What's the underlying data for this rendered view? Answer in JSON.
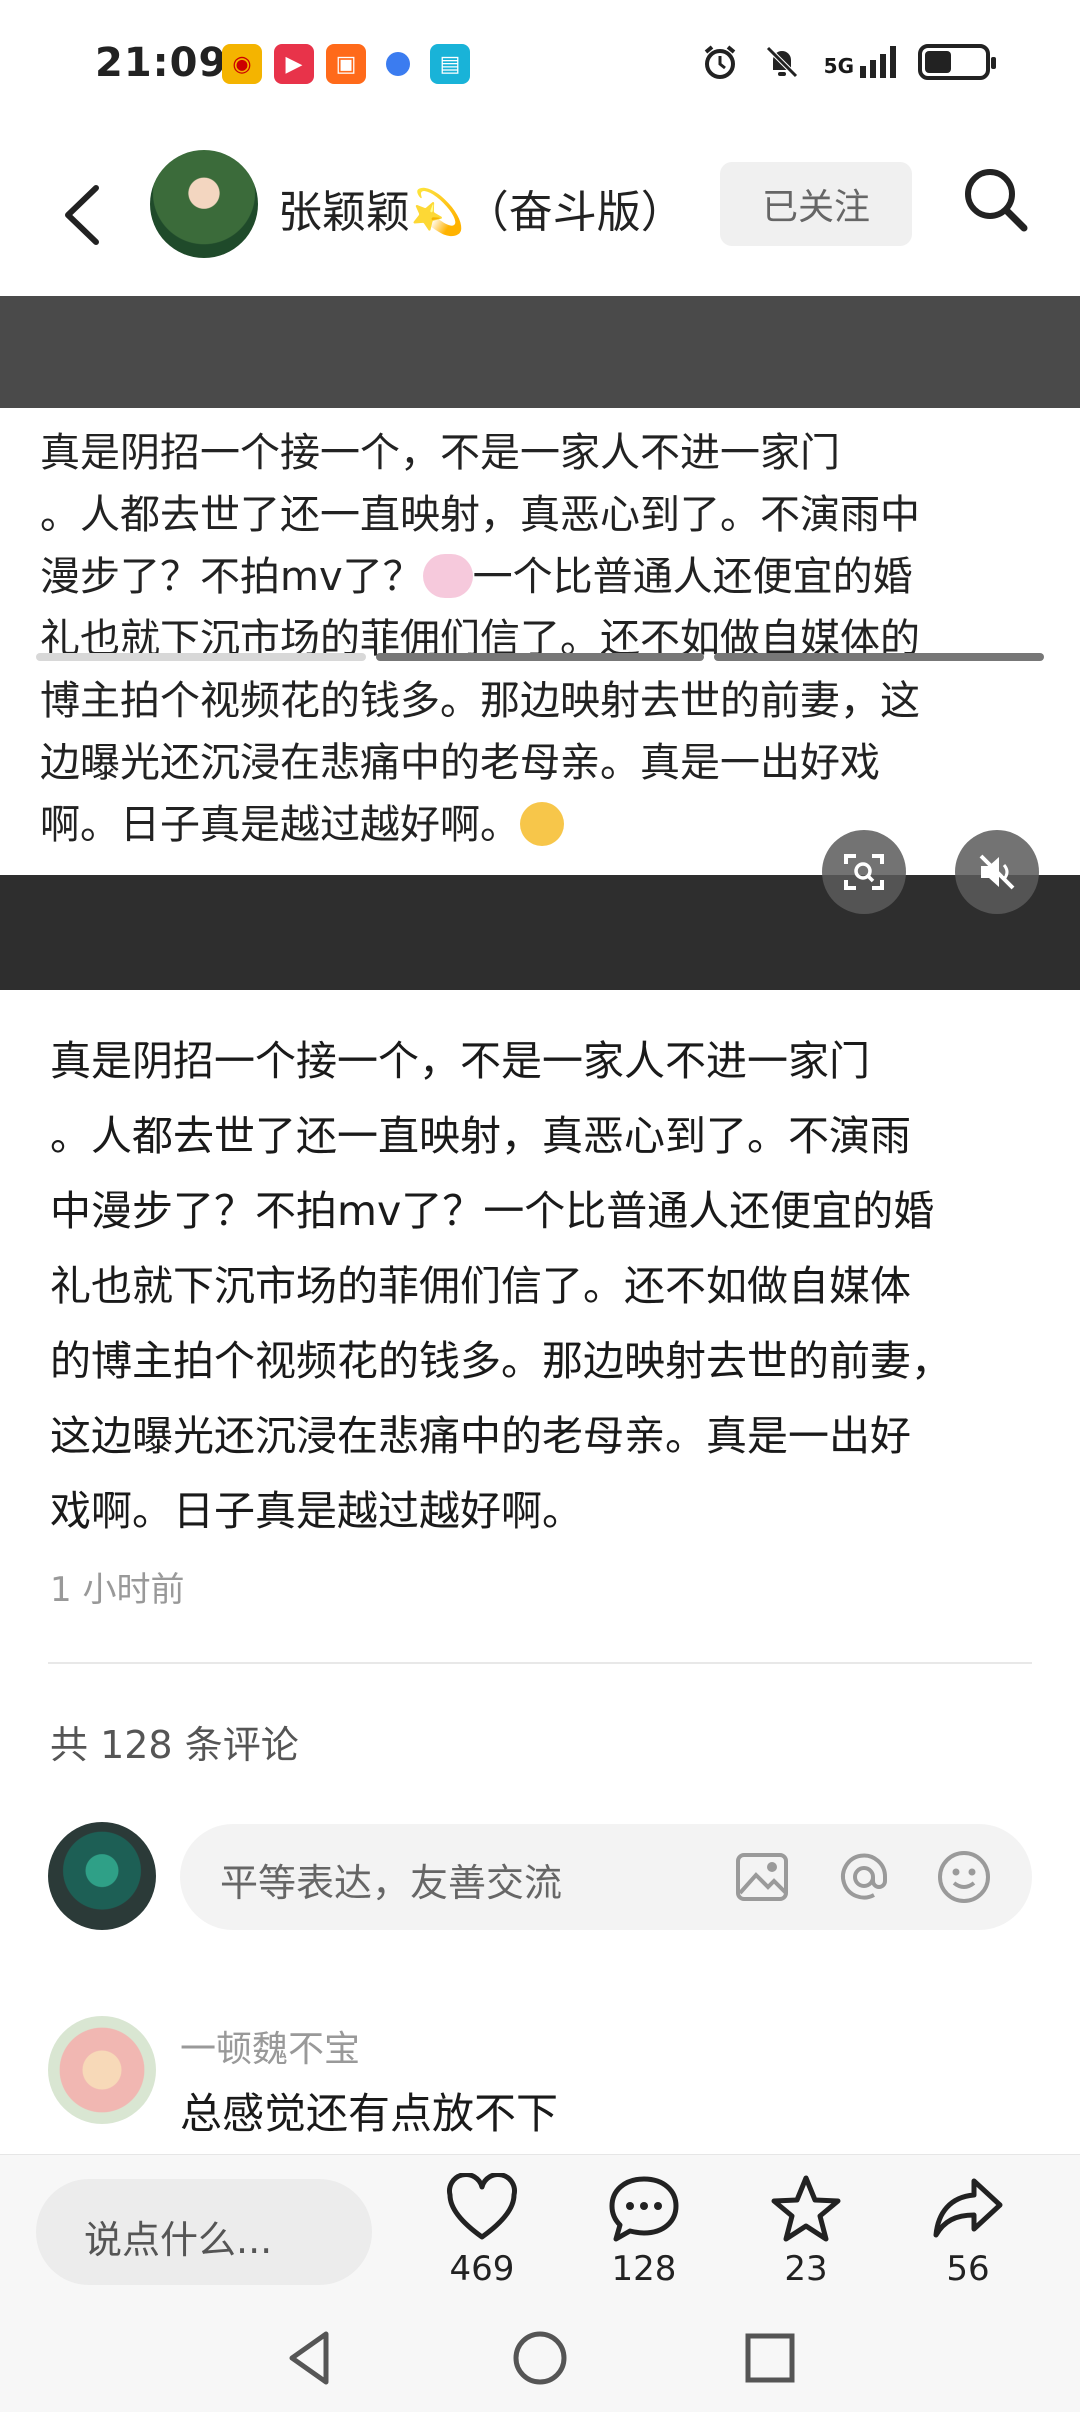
{
  "status_bar": {
    "time": "21:09",
    "network": "5G",
    "battery_level_percent": 40
  },
  "header": {
    "author": "张颖颖💫（奋斗版）",
    "follow_label": "已关注"
  },
  "media": {
    "lines": [
      "真是阴招一个接一个，不是一家人不进一家门",
      "。人都去世了还一直映射，真恶心到了。不演雨中",
      "漫步了？不拍mv了？",
      "一个比普通人还便宜的婚",
      "礼也就下沉市场的菲佣们信了。还不如做自媒体的",
      "博主拍个视频花的钱多。那边映射去世的前妻，这",
      "边曝光还沉浸在悲痛中的老母亲。真是一出好戏",
      "啊。日子真是越过越好啊。"
    ],
    "active_page": 1,
    "page_count": 3
  },
  "post": {
    "lines": [
      "真是阴招一个接一个，不是一家人不进一家门",
      "。人都去世了还一直映射，真恶心到了。不演雨",
      "中漫步了？不拍mv了？一个比普通人还便宜的婚",
      "礼也就下沉市场的菲佣们信了。还不如做自媒体",
      "的博主拍个视频花的钱多。那边映射去世的前妻，",
      "这边曝光还沉浸在悲痛中的老母亲。真是一出好",
      "戏啊。日子真是越过越好啊。"
    ],
    "time": "1 小时前"
  },
  "comments": {
    "count_label": "共 128 条评论",
    "input_placeholder": "平等表达，友善交流",
    "items": [
      {
        "user": "一顿魏不宝",
        "text": "总感觉还有点放不下"
      }
    ]
  },
  "action_bar": {
    "input_placeholder": "说点什么...",
    "likes": "469",
    "comments": "128",
    "favorites": "23",
    "shares": "56"
  }
}
